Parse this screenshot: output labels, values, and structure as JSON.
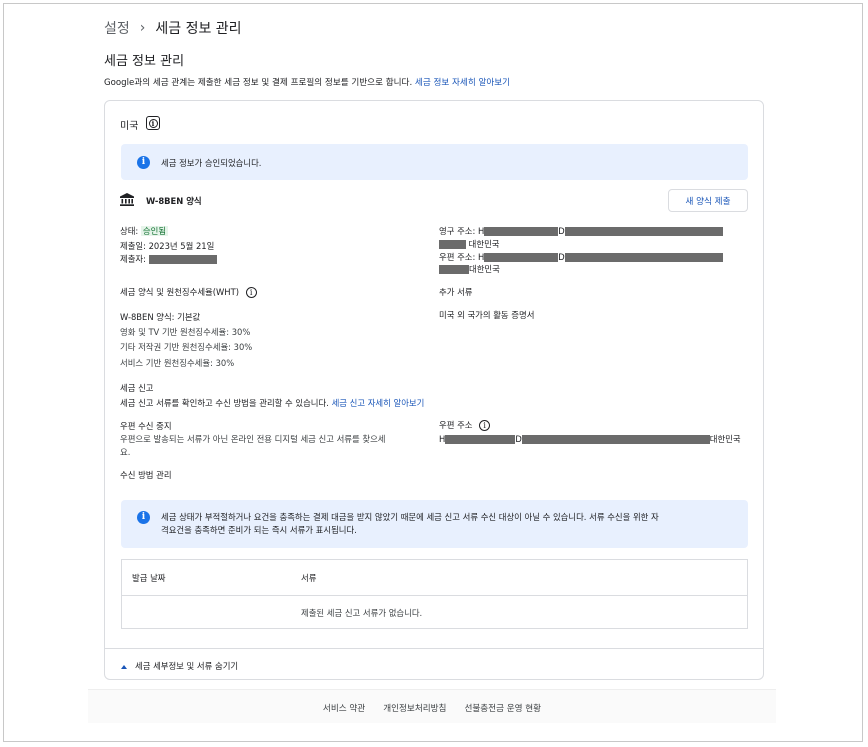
{
  "breadcrumb": {
    "parent": "설정",
    "separator": "›",
    "current": "세금 정보 관리"
  },
  "page": {
    "title": "세금 정보 관리",
    "intro": "Google과의 세금 관계는 제출한 세금 정보 및 결제 프로필의 정보를 기반으로 합니다.",
    "intro_link": "세금 정보 자세히 알아보기"
  },
  "card": {
    "country": "미국",
    "approved_banner": "세금 정보가 승인되었습니다.",
    "form": {
      "name": "W-8BEN 양식",
      "new_form_button": "새 양식 제출",
      "status_label": "상태:",
      "status_value": "승인됨",
      "submitted_date": "제출일: 2023년 5월 21일",
      "submitter_label": "제출자:",
      "permanent_address_label": "영구 주소: H",
      "address_d": "D",
      "country_kr_a": "대한민국",
      "mailing_address_label": "우편 주소: H",
      "country_kr_b": "대한민국"
    },
    "wht": {
      "heading": "세금 양식 및 원천징수세율(WHT)",
      "form_link": "W-8BEN 양식: 기본값",
      "rate1": "영화 및 TV 기반 원천징수세율: 30%",
      "rate2": "기타 저작권 기반 원천징수세율: 30%",
      "rate3": "서비스 기반 원천징수세율: 30%"
    },
    "additional_docs": {
      "heading": "추가 서류",
      "link": "미국 외 국가의 활동 증명서"
    },
    "tax_reporting": {
      "heading": "세금 신고",
      "desc": "세금 신고 서류를 확인하고 수신 방법을 관리할 수 있습니다.",
      "desc_link": "세금 신고 자세히 알아보기",
      "mail_stop_label": "우편 수신 중지",
      "mail_stop_desc1": "우편으로 발송되는 서류가 아닌 온라인 전용 디지털 세금 신고 서류를 찾으세",
      "mail_stop_desc2": "요.",
      "mail_address_label": "우편 주소",
      "mail_address_h": "H",
      "mail_address_d": "D",
      "mail_address_country": "대한민국",
      "manage_link": "수신 방법 관리"
    },
    "warning": {
      "line1": "세금 상태가 부적절하거나 요건을 충족하는 결제 대금을 받지 않았기 때문에 세금 신고 서류 수신 대상이 아닐 수 있습니다. 서류 수신을 위한 자",
      "line2": "격요건을 충족하면 준비가 되는 즉시 서류가 표시됩니다."
    },
    "table": {
      "col_date": "발급 날짜",
      "col_docs": "서류",
      "empty": "제출된 세금 신고 서류가 없습니다."
    },
    "collapse_link": "세금 세부정보 및 서류 숨기기"
  },
  "footer": {
    "terms": "서비스 약관",
    "privacy": "개인정보처리방침",
    "prepaid": "선불충전금 운영 현황"
  },
  "colors": {
    "link": "#1a56b8",
    "info_bg": "#e8f0fe",
    "info_icon": "#1a73e8",
    "approved_bg": "#e6f4ea",
    "approved_text": "#137333"
  }
}
